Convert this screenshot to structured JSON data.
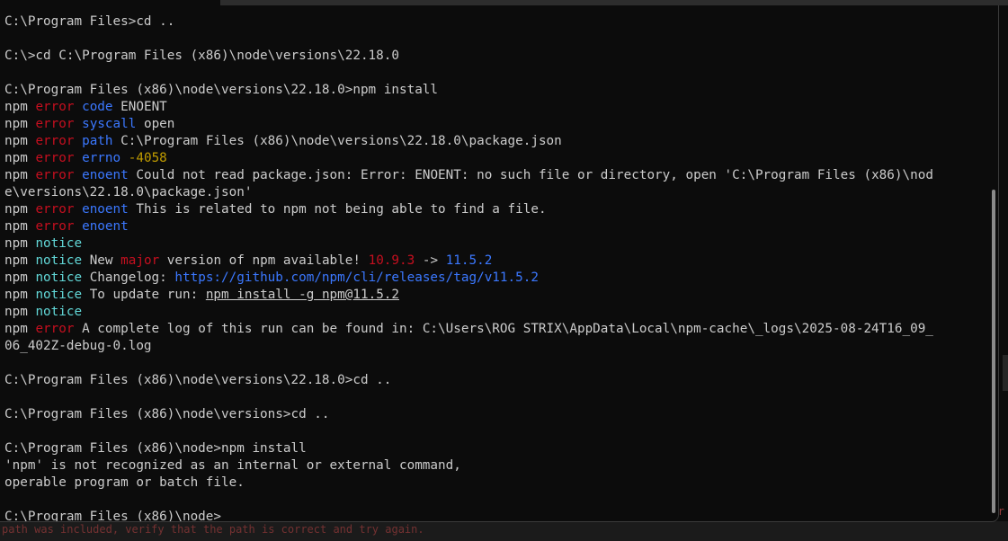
{
  "terminal": {
    "lines": [
      [
        {
          "t": "C:\\Program Files>cd ..",
          "c": "default"
        }
      ],
      [],
      [
        {
          "t": "C:\\>cd C:\\Program Files (x86)\\node\\versions\\22.18.0",
          "c": "default"
        }
      ],
      [],
      [
        {
          "t": "C:\\Program Files (x86)\\node\\versions\\22.18.0>npm install",
          "c": "default"
        }
      ],
      [
        {
          "t": "npm ",
          "c": "default"
        },
        {
          "t": "error",
          "c": "red"
        },
        {
          "t": " ",
          "c": "default"
        },
        {
          "t": "code",
          "c": "blue"
        },
        {
          "t": " ENOENT",
          "c": "default"
        }
      ],
      [
        {
          "t": "npm ",
          "c": "default"
        },
        {
          "t": "error",
          "c": "red"
        },
        {
          "t": " ",
          "c": "default"
        },
        {
          "t": "syscall",
          "c": "blue"
        },
        {
          "t": " open",
          "c": "default"
        }
      ],
      [
        {
          "t": "npm ",
          "c": "default"
        },
        {
          "t": "error",
          "c": "red"
        },
        {
          "t": " ",
          "c": "default"
        },
        {
          "t": "path",
          "c": "blue"
        },
        {
          "t": " C:\\Program Files (x86)\\node\\versions\\22.18.0\\package.json",
          "c": "default"
        }
      ],
      [
        {
          "t": "npm ",
          "c": "default"
        },
        {
          "t": "error",
          "c": "red"
        },
        {
          "t": " ",
          "c": "default"
        },
        {
          "t": "errno",
          "c": "blue"
        },
        {
          "t": " ",
          "c": "default"
        },
        {
          "t": "-4058",
          "c": "yellow"
        }
      ],
      [
        {
          "t": "npm ",
          "c": "default"
        },
        {
          "t": "error",
          "c": "red"
        },
        {
          "t": " ",
          "c": "default"
        },
        {
          "t": "enoent",
          "c": "blue"
        },
        {
          "t": " Could not read package.json: Error: ENOENT: no such file or directory, open 'C:\\Program Files (x86)\\nod",
          "c": "default"
        }
      ],
      [
        {
          "t": "e\\versions\\22.18.0\\package.json'",
          "c": "default"
        }
      ],
      [
        {
          "t": "npm ",
          "c": "default"
        },
        {
          "t": "error",
          "c": "red"
        },
        {
          "t": " ",
          "c": "default"
        },
        {
          "t": "enoent",
          "c": "blue"
        },
        {
          "t": " This is related to npm not being able to find a file.",
          "c": "default"
        }
      ],
      [
        {
          "t": "npm ",
          "c": "default"
        },
        {
          "t": "error",
          "c": "red"
        },
        {
          "t": " ",
          "c": "default"
        },
        {
          "t": "enoent",
          "c": "blue"
        }
      ],
      [
        {
          "t": "npm ",
          "c": "default"
        },
        {
          "t": "notice",
          "c": "cyan"
        }
      ],
      [
        {
          "t": "npm ",
          "c": "default"
        },
        {
          "t": "notice",
          "c": "cyan"
        },
        {
          "t": " New ",
          "c": "default"
        },
        {
          "t": "major",
          "c": "red"
        },
        {
          "t": " version of npm available! ",
          "c": "default"
        },
        {
          "t": "10.9.3",
          "c": "red"
        },
        {
          "t": " -> ",
          "c": "default"
        },
        {
          "t": "11.5.2",
          "c": "blue"
        }
      ],
      [
        {
          "t": "npm ",
          "c": "default"
        },
        {
          "t": "notice",
          "c": "cyan"
        },
        {
          "t": " Changelog: ",
          "c": "default"
        },
        {
          "t": "https://github.com/npm/cli/releases/tag/v11.5.2",
          "c": "link"
        }
      ],
      [
        {
          "t": "npm ",
          "c": "default"
        },
        {
          "t": "notice",
          "c": "cyan"
        },
        {
          "t": " To update run: ",
          "c": "default"
        },
        {
          "t": "npm install -g npm@11.5.2",
          "c": "default",
          "u": true
        }
      ],
      [
        {
          "t": "npm ",
          "c": "default"
        },
        {
          "t": "notice",
          "c": "cyan"
        }
      ],
      [
        {
          "t": "npm ",
          "c": "default"
        },
        {
          "t": "error",
          "c": "red"
        },
        {
          "t": " A complete log of this run can be found in: C:\\Users\\ROG STRIX\\AppData\\Local\\npm-cache\\_logs\\2025-08-24T16_09_",
          "c": "default"
        }
      ],
      [
        {
          "t": "06_402Z-debug-0.log",
          "c": "default"
        }
      ],
      [],
      [
        {
          "t": "C:\\Program Files (x86)\\node\\versions\\22.18.0>cd ..",
          "c": "default"
        }
      ],
      [],
      [
        {
          "t": "C:\\Program Files (x86)\\node\\versions>cd ..",
          "c": "default"
        }
      ],
      [],
      [
        {
          "t": "C:\\Program Files (x86)\\node>npm install",
          "c": "default"
        }
      ],
      [
        {
          "t": "'npm' is not recognized as an internal or external command,",
          "c": "default"
        }
      ],
      [
        {
          "t": "operable program or batch file.",
          "c": "default"
        }
      ],
      [],
      [
        {
          "t": "C:\\Program Files (x86)\\node>",
          "c": "default"
        }
      ]
    ]
  },
  "background_window": {
    "partial_text": "path was included, verify that the path is correct and try again.",
    "edge_char": "r"
  },
  "colors": {
    "background": "#0c0c0c",
    "foreground": "#cccccc",
    "red": "#c50f1f",
    "blue": "#3b78ff",
    "cyan": "#61d6d6",
    "yellow": "#c19c00"
  }
}
